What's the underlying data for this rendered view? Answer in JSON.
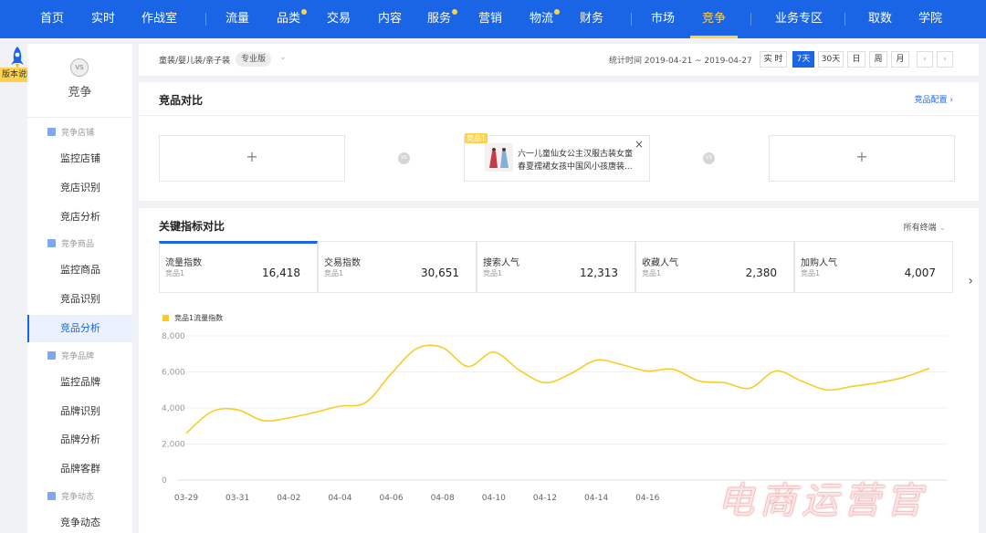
{
  "topnav": {
    "items": [
      "首页",
      "实时",
      "作战室",
      "流量",
      "品类",
      "交易",
      "内容",
      "服务",
      "营销",
      "物流",
      "财务",
      "市场",
      "竞争",
      "业务专区",
      "取数",
      "学院"
    ],
    "active": "竞争"
  },
  "version_badge": "版本说明",
  "sidebar": {
    "logo_text": "VS",
    "title": "竞争",
    "groups": [
      {
        "label": "竞争店铺",
        "items": [
          "监控店铺",
          "竞店识别",
          "竞店分析"
        ]
      },
      {
        "label": "竞争商品",
        "items": [
          "监控商品",
          "竞品识别",
          "竞品分析"
        ]
      },
      {
        "label": "竞争品牌",
        "items": [
          "监控品牌",
          "品牌识别",
          "品牌分析",
          "品牌客群"
        ]
      },
      {
        "label": "竞争动态",
        "items": [
          "竞争动态"
        ]
      }
    ],
    "active_item": "竞品分析"
  },
  "filterbar": {
    "category": "童装/婴儿装/亲子装",
    "edition": "专业版",
    "stat_time": "统计时间 2019-04-21 ~ 2019-04-27",
    "buttons": [
      "实 时",
      "7天",
      "30天",
      "日",
      "周",
      "月"
    ],
    "active_button": "7天",
    "prev": "‹",
    "next": "›"
  },
  "compare": {
    "title": "竞品对比",
    "config_link": "竞品配置 ›",
    "plus": "+",
    "vs": "VS",
    "product": {
      "tag": "竞品1",
      "name": "六一儿童仙女公主汉服古装女童春夏襦裙女孩中国风小孩唐装...",
      "close": "×"
    }
  },
  "metrics": {
    "title": "关键指标对比",
    "scope": "所有终端",
    "scope_chevron": "⌄",
    "next_arrow": "›",
    "cards": [
      {
        "name": "流量指数",
        "sub": "竞品1",
        "value": "16,418"
      },
      {
        "name": "交易指数",
        "sub": "竞品1",
        "value": "30,651"
      },
      {
        "name": "搜索人气",
        "sub": "竞品1",
        "value": "12,313"
      },
      {
        "name": "收藏人气",
        "sub": "竞品1",
        "value": "2,380"
      },
      {
        "name": "加购人气",
        "sub": "竞品1",
        "value": "4,007"
      }
    ]
  },
  "chart_data": {
    "type": "line",
    "legend": "竞品1流量指数",
    "color": "#f7cd25",
    "x": [
      "03-29",
      "03-30",
      "03-31",
      "04-01",
      "04-02",
      "04-03",
      "04-04",
      "04-05",
      "04-06",
      "04-07",
      "04-08",
      "04-09",
      "04-10",
      "04-11",
      "04-12",
      "04-13",
      "04-14",
      "04-15",
      "04-16",
      "04-17",
      "04-18",
      "04-19",
      "04-20",
      "04-21",
      "04-22",
      "04-23",
      "04-24",
      "04-25",
      "04-26",
      "04-27"
    ],
    "xticks": [
      "03-29",
      "03-31",
      "04-02",
      "04-04",
      "04-06",
      "04-08",
      "04-10",
      "04-12",
      "04-14",
      "04-16"
    ],
    "series": [
      {
        "values": [
          2600,
          3800,
          3900,
          3300,
          3450,
          3750,
          4100,
          4300,
          5900,
          7300,
          7350,
          6300,
          7100,
          6100,
          5400,
          5900,
          6650,
          6400,
          6050,
          6150,
          5500,
          5400,
          5100,
          6050,
          5500,
          5000,
          5200,
          5400,
          5700,
          6200
        ]
      }
    ],
    "ylim": [
      0,
      8000
    ],
    "yticks": [
      "0",
      "2,000",
      "4,000",
      "6,000",
      "8,000"
    ]
  },
  "watermark": "电商运营官"
}
